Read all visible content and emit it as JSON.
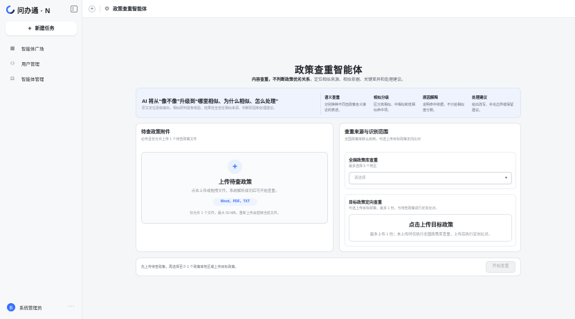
{
  "app": {
    "name": "问办通 · N"
  },
  "sidebar": {
    "new_task": "新建任务",
    "items": [
      {
        "label": "智能体广场",
        "icon": "grid-icon"
      },
      {
        "label": "用户管理",
        "icon": "users-icon"
      },
      {
        "label": "智能体管理",
        "icon": "bot-icon"
      }
    ],
    "user": {
      "avatar": "系",
      "name": "系统管理员",
      "more": "···"
    }
  },
  "topbar": {
    "title": "政策查重智能体"
  },
  "hero": {
    "title": "政策查重智能体",
    "subtitle_bold": "内容查重，不判断政策优劣关系",
    "subtitle_rest": "，定位相似来源、相似依据、关键差异和处理建议。"
  },
  "banner": {
    "heading": "AI 将从“像不像”升级到“哪里相似、为什么相似、怎么处理”",
    "desc": "原文定位逐级输出。相似研判逐条核验，结果完全自位相似来源、判断原因和处理建议。",
    "features": [
      {
        "title": "语义查重",
        "desc": "识别换种不同但政策含义接近的表述。"
      },
      {
        "title": "相似分级",
        "desc": "区分高相似、中相似和低相似命中项。"
      },
      {
        "title": "原因解释",
        "desc": "说明命中依据，不只给相似度分数。"
      },
      {
        "title": "处理建议",
        "desc": "给出改写、补充边界或保留建议。"
      }
    ]
  },
  "upload": {
    "heading": "待查政策附件",
    "desc": "必传且仅允许上传 1 个待查政策文件",
    "box_title": "上传待查政策",
    "box_desc": "点击上传或拖拽文件，系统解析成功后可开始查重。",
    "types": "Word、PDF、TXT",
    "limit": "仅允许 1 个文件，最大 50 MB，重新上传会替换当前文件。"
  },
  "source": {
    "heading": "查重来源与识别范围",
    "desc": "全国政策库默认启用，可选上传目标政策定向比对",
    "national": {
      "title": "全国政策库查重",
      "desc": "最多选择 5 个地区",
      "placeholder": "请选择"
    },
    "target": {
      "title": "目标政策定向查重",
      "desc": "可选上传目标政策，最多 1 份，与待查政策进行定向比对。",
      "btn_title": "点击上传目标政策",
      "btn_desc": "最多上传 1 份；未上传时仅执行全国政策库查重，上传后执行定向比对。"
    }
  },
  "footer": {
    "text": "先上传待查政策，再选择至少 1 个政策库地区或上传目标政策。",
    "start": "开始查重"
  },
  "colors": {
    "accent": "#3370ff",
    "banner_bg": "#eef3fd"
  }
}
